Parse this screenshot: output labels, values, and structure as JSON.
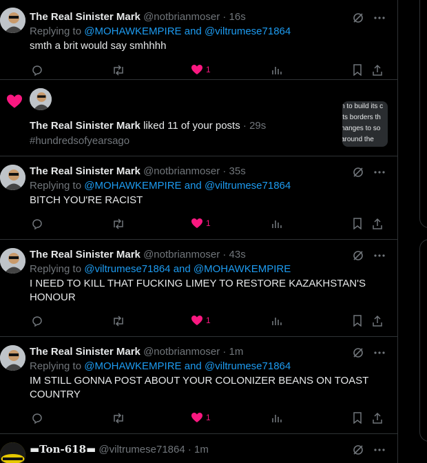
{
  "colors": {
    "background": "#000000",
    "text": "#e7e9ea",
    "muted": "#71767b",
    "link": "#1d9bf0",
    "like": "#f91880",
    "border": "#2f3336"
  },
  "tweets": [
    {
      "name": "The Real Sinister Mark",
      "handle": "@notbrianmoser",
      "dot": "·",
      "time": "16s",
      "reply_prefix": "Replying to",
      "mention1": "@MOHAWKEMPIRE",
      "and": "and",
      "mention2": "@viltrumese71864",
      "text": "smth a brit would say smhhhh",
      "likes": "1"
    },
    {
      "name": "The Real Sinister Mark",
      "handle": "@notbrianmoser",
      "dot": "·",
      "time": "35s",
      "reply_prefix": "Replying to",
      "mention1": "@MOHAWKEMPIRE",
      "and": "and",
      "mention2": "@viltrumese71864",
      "text": "BITCH YOU'RE RACIST",
      "likes": "1"
    },
    {
      "name": "The Real Sinister Mark",
      "handle": "@notbrianmoser",
      "dot": "·",
      "time": "43s",
      "reply_prefix": "Replying to",
      "mention1": "@viltrumese71864",
      "and": "and",
      "mention2": "@MOHAWKEMPIRE",
      "text": "I NEED TO KILL THAT FUCKING LIMEY TO RESTORE KAZAKHSTAN'S HONOUR",
      "likes": "1"
    },
    {
      "name": "The Real Sinister Mark",
      "handle": "@notbrianmoser",
      "dot": "·",
      "time": "1m",
      "reply_prefix": "Replying to",
      "mention1": "@MOHAWKEMPIRE",
      "and": "and",
      "mention2": "@viltrumese71864",
      "text": "IM STILL GONNA POST ABOUT YOUR COLONIZER BEANS ON TOAST COUNTRY",
      "likes": "1"
    }
  ],
  "notification": {
    "name": "The Real Sinister Mark",
    "action": "liked 11 of your posts",
    "dot": "·",
    "time": "29s",
    "hashtag": "#hundredsofyearsago",
    "thumb_lines": [
      "n to build its c",
      "its borders th",
      "hanges to so",
      "around the"
    ]
  },
  "last_tweet": {
    "name": "▬Ton-618▬",
    "handle": "@viltrumese71864",
    "dot": "·",
    "time": "1m"
  },
  "icons": [
    "avatar",
    "grok-icon",
    "more-icon",
    "reply-icon",
    "retweet-icon",
    "like-icon",
    "views-icon",
    "bookmark-icon",
    "share-icon",
    "heart-notification-icon"
  ]
}
